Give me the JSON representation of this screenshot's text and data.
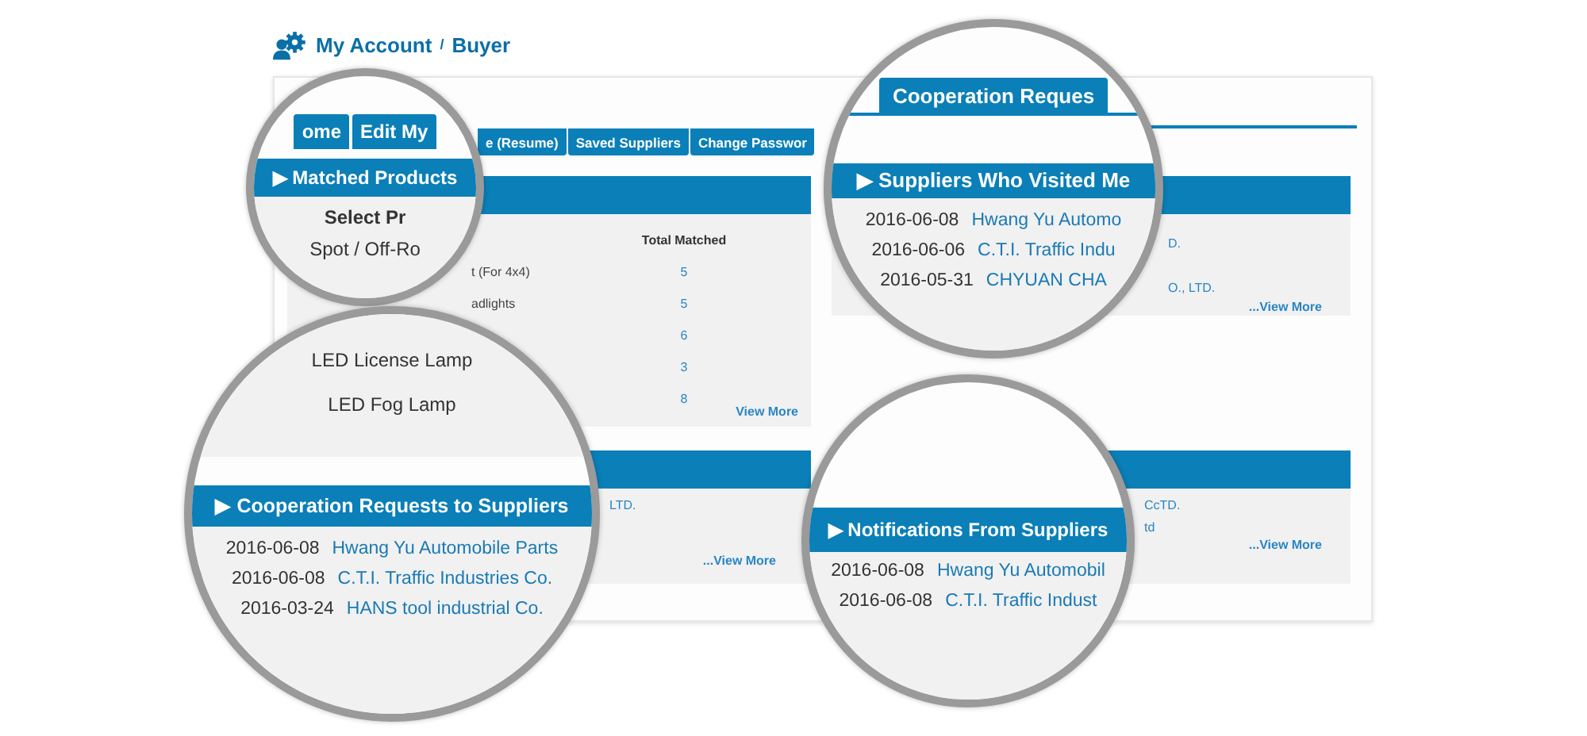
{
  "page_title": {
    "account": "My Account",
    "separator": "/",
    "role": "Buyer"
  },
  "sub_tabs": [
    "e (Resume)",
    "Saved Suppliers",
    "Change Passwor"
  ],
  "panels": [
    {
      "kind": "products",
      "column_header": "Total Matched",
      "rows": [
        {
          "name": "t (For 4x4)",
          "count": "5"
        },
        {
          "name": "adlights",
          "count": "5"
        },
        {
          "count": "6"
        },
        {
          "count": "3"
        },
        {
          "count": "8"
        }
      ],
      "more": "View More"
    },
    {
      "kind": "list",
      "rows": [
        "D.",
        "O., LTD."
      ],
      "more": "...View More"
    },
    {
      "kind": "list",
      "rows": [
        "LTD."
      ],
      "more": "...View More"
    },
    {
      "kind": "list",
      "rows": [
        "CcTD.",
        "td"
      ],
      "more": "...View More"
    }
  ],
  "magnifiers": [
    {
      "blocks": [
        {
          "kind": "tabs",
          "items": [
            "ome",
            "Edit My"
          ]
        },
        {
          "kind": "header",
          "text": "▶ Matched Products"
        },
        {
          "kind": "names",
          "items": [
            {
              "text": "Select Pr",
              "heading": true
            },
            {
              "text": "Spot / Off-Ro",
              "heading": false
            }
          ]
        }
      ]
    },
    {
      "blocks": [
        {
          "kind": "tabs",
          "items": [
            "Cooperation Reques"
          ]
        },
        {
          "kind": "header",
          "text": "▶ Suppliers Who Visited Me"
        },
        {
          "kind": "records",
          "rows": [
            {
              "date": "2016-06-08",
              "name": "Hwang Yu Automo"
            },
            {
              "date": "2016-06-06",
              "name": "C.T.I. Traffic Indu"
            },
            {
              "date": "2016-05-31",
              "name": "CHYUAN CHA"
            }
          ]
        }
      ]
    },
    {
      "blocks": [
        {
          "kind": "names",
          "items": [
            {
              "text": "LED License Lamp",
              "heading": false
            },
            {
              "text": "LED Fog Lamp",
              "heading": false
            }
          ]
        },
        {
          "kind": "header",
          "text": "▶ Cooperation Requests to Suppliers"
        },
        {
          "kind": "records",
          "rows": [
            {
              "date": "2016-06-08",
              "name": "Hwang Yu Automobile Parts"
            },
            {
              "date": "2016-06-08",
              "name": "C.T.I. Traffic Industries Co."
            },
            {
              "date": "2016-03-24",
              "name": "HANS tool industrial Co."
            }
          ]
        }
      ]
    },
    {
      "blocks": [
        {
          "kind": "header",
          "text": "▶ Notifications From Suppliers"
        },
        {
          "kind": "records",
          "rows": [
            {
              "date": "2016-06-08",
              "name": "Hwang Yu Automobil"
            },
            {
              "date": "2016-06-08",
              "name": "C.T.I. Traffic Indust"
            }
          ]
        }
      ]
    }
  ]
}
